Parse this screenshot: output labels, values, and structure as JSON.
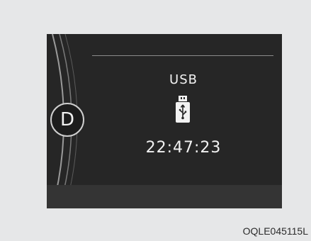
{
  "cluster": {
    "gear": "D",
    "media_source": "USB",
    "media_icon": "usb-drive-icon",
    "clock": "22:47:23"
  },
  "figure_code": "OQLE045115L"
}
